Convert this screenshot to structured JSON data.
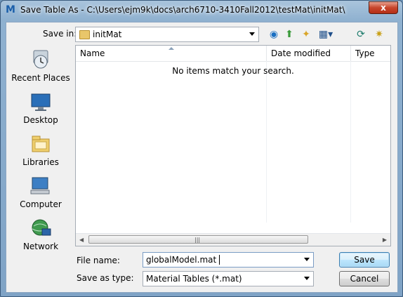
{
  "window": {
    "title": "Save Table As - C:\\Users\\ejm9k\\docs\\arch6710-3410Fall2012\\testMat\\initMat\\",
    "close_glyph": "x"
  },
  "toolbar": {
    "save_in_label": "Save in:",
    "save_in_value": "initMat",
    "icons": [
      "back-icon",
      "up-folder-icon",
      "new-folder-icon",
      "view-menu-icon",
      "refresh-icon",
      "favorites-icon"
    ]
  },
  "places": [
    {
      "label": "Recent Places",
      "icon": "recent-places-icon"
    },
    {
      "label": "Desktop",
      "icon": "desktop-icon"
    },
    {
      "label": "Libraries",
      "icon": "libraries-icon"
    },
    {
      "label": "Computer",
      "icon": "computer-icon"
    },
    {
      "label": "Network",
      "icon": "network-icon"
    }
  ],
  "file_list": {
    "columns": [
      "Name",
      "Date modified",
      "Type"
    ],
    "empty_message": "No items match your search."
  },
  "form": {
    "file_name_label": "File name:",
    "file_name_value": "globalModel.mat",
    "save_type_label": "Save as type:",
    "save_type_value": "Material Tables (*.mat)"
  },
  "buttons": {
    "save": "Save",
    "cancel": "Cancel"
  },
  "colors": {
    "titlebar": "#9dbbd6",
    "close": "#c7452c",
    "primary_button": "#bee6fd"
  }
}
